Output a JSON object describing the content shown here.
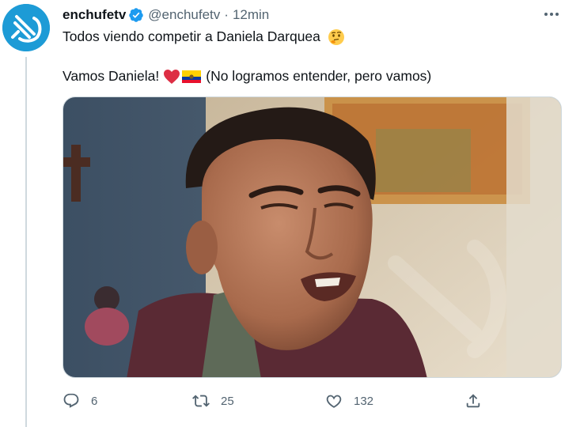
{
  "tweet": {
    "display_name": "enchufetv",
    "handle": "@enchufetv",
    "separator": "·",
    "time": "12min",
    "line1": "Todos viendo competir a Daniela Darquea",
    "line2_start": "Vamos Daniela!",
    "line2_end": "(No logramos entender, pero vamos)",
    "emojis": [
      "thinking-face",
      "red-heart",
      "ecuador-flag"
    ]
  },
  "actions": {
    "reply_count": "6",
    "retweet_count": "25",
    "like_count": "132"
  },
  "icons": [
    "verified-badge-icon",
    "more-options-icon",
    "reply-icon",
    "retweet-icon",
    "like-icon",
    "share-icon"
  ],
  "colors": {
    "accent": "#1d9bf0",
    "text": "#0f1419",
    "secondary": "#536471",
    "thread_line": "#cfd9de",
    "heart": "#dd2e44"
  }
}
